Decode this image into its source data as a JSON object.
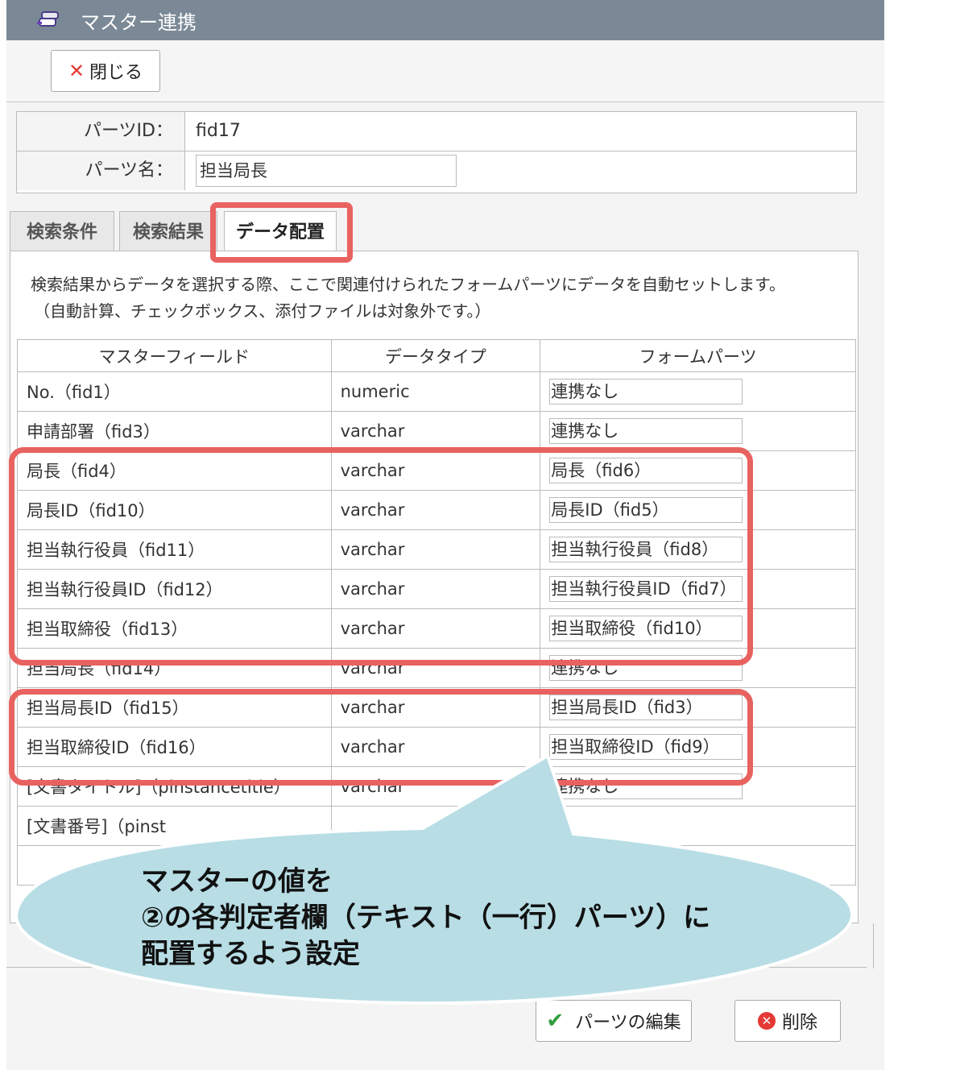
{
  "window": {
    "title": "マスター連携",
    "icon": "link-icon"
  },
  "toolbar": {
    "close_label": "閉じる"
  },
  "info": {
    "parts_id_label": "パーツID：",
    "parts_id_value": "fid17",
    "parts_name_label": "パーツ名：",
    "parts_name_value": "担当局長"
  },
  "tabs": [
    {
      "label": "検索条件",
      "active": false
    },
    {
      "label": "検索結果",
      "active": false
    },
    {
      "label": "データ配置",
      "active": true
    }
  ],
  "description": {
    "line1": "検索結果からデータを選択する際、ここで関連付けられたフォームパーツにデータを自動セットします。",
    "line2": "（自動計算、チェックボックス、添付ファイルは対象外です。）"
  },
  "table": {
    "headers": [
      "マスターフィールド",
      "データタイプ",
      "フォームパーツ"
    ],
    "rows": [
      {
        "field": "No.（fid1）",
        "type": "numeric",
        "part": "連携なし"
      },
      {
        "field": "申請部署（fid3）",
        "type": "varchar",
        "part": "連携なし"
      },
      {
        "field": "局長（fid4）",
        "type": "varchar",
        "part": "局長（fid6）"
      },
      {
        "field": "局長ID（fid10）",
        "type": "varchar",
        "part": "局長ID（fid5）"
      },
      {
        "field": "担当執行役員（fid11）",
        "type": "varchar",
        "part": "担当執行役員（fid8）"
      },
      {
        "field": "担当執行役員ID（fid12）",
        "type": "varchar",
        "part": "担当執行役員ID（fid7）"
      },
      {
        "field": "担当取締役（fid13）",
        "type": "varchar",
        "part": "担当取締役（fid10）"
      },
      {
        "field": "担当局長（fid14）",
        "type": "varchar",
        "part": "連携なし"
      },
      {
        "field": "担当局長ID（fid15）",
        "type": "varchar",
        "part": "担当局長ID（fid3）"
      },
      {
        "field": "担当取締役ID（fid16）",
        "type": "varchar",
        "part": "担当取締役ID（fid9）"
      },
      {
        "field": "[文書タイトル]（pinstancetitle）",
        "type": "varchar",
        "part": "連携なし"
      },
      {
        "field": "[文書番号]（pinst",
        "type": "",
        "part": ""
      }
    ]
  },
  "callout": {
    "line1": "マスターの値を",
    "line2": "②の各判定者欄（テキスト（一行）パーツ）に",
    "line3": "配置するよう設定"
  },
  "footer": {
    "edit_label": "パーツの編集",
    "delete_label": "削除"
  },
  "colors": {
    "titlebar": "#7a8995",
    "highlight": "#e8625f",
    "callout": "#b8dde5"
  }
}
